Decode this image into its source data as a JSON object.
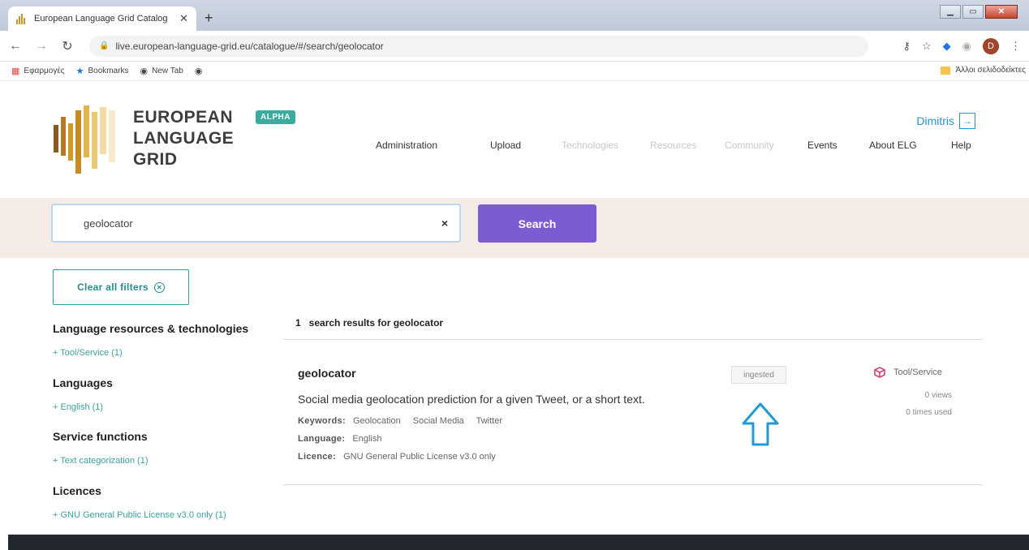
{
  "browser": {
    "tab_title": "European Language Grid Catalog",
    "url": "live.european-language-grid.eu/catalogue/#/search/geolocator",
    "bookmarks": [
      "Εφαρμογές",
      "Bookmarks",
      "New Tab"
    ],
    "other_bookmarks": "Άλλοι σελιδοδείκτες",
    "profile_initial": "D"
  },
  "header": {
    "brand_line1": "EUROPEAN",
    "brand_line2": "LANGUAGE",
    "brand_line3": "GRID",
    "badge": "ALPHA",
    "user": "Dimitris",
    "nav": [
      {
        "label": "Administration",
        "enabled": true
      },
      {
        "label": "Upload",
        "enabled": true
      },
      {
        "label": "Technologies",
        "enabled": false
      },
      {
        "label": "Resources",
        "enabled": false
      },
      {
        "label": "Community",
        "enabled": false
      },
      {
        "label": "Events",
        "enabled": true
      },
      {
        "label": "About ELG",
        "enabled": true
      },
      {
        "label": "Help",
        "enabled": true
      }
    ]
  },
  "search": {
    "value": "geolocator",
    "clear_glyph": "×",
    "button": "Search"
  },
  "filters": {
    "clear_label": "Clear all filters",
    "groups": [
      {
        "title": "Language resources & technologies",
        "item": "+ Tool/Service (1)"
      },
      {
        "title": "Languages",
        "item": "+ English (1)"
      },
      {
        "title": "Service functions",
        "item": "+ Text categorization (1)"
      },
      {
        "title": "Licences",
        "item": "+ GNU General Public License v3.0 only (1)"
      }
    ]
  },
  "results": {
    "count_text": "1   search results for geolocator",
    "item": {
      "title": "geolocator",
      "description": "Social media geolocation prediction for a given Tweet, or a short text.",
      "keywords_label": "Keywords:",
      "keywords": [
        "Geolocation",
        "Social Media",
        "Twitter"
      ],
      "language_label": "Language:",
      "language": "English",
      "licence_label": "Licence:",
      "licence": "GNU General Public License v3.0 only",
      "status_badge": "ingested",
      "type": "Tool/Service",
      "views": "0 views",
      "times_used": "0 times used"
    }
  },
  "colors": {
    "accent_teal": "#2aa39a",
    "search_button": "#7c5bd3",
    "link_blue": "#2a92c7",
    "search_band": "#f6ece7",
    "annotation_arrow": "#1e9ad6"
  }
}
